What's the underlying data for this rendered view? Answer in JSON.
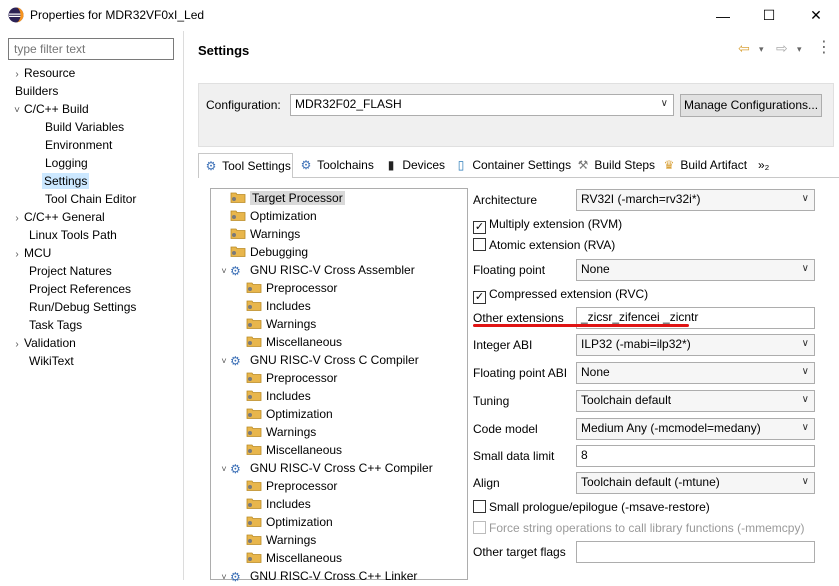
{
  "window": {
    "title": "Properties for MDR32VF0xI_Led",
    "minimize": "—",
    "maximize": "☐",
    "close": "✕"
  },
  "sidebar": {
    "filter_placeholder": "type filter text",
    "items": [
      {
        "label": "Resource",
        "arrow": "›"
      },
      {
        "label": "Builders",
        "arrow": ""
      },
      {
        "label": "C/C++ Build",
        "arrow": "˅"
      },
      {
        "label": "Build Variables",
        "arrow": ""
      },
      {
        "label": "Environment",
        "arrow": ""
      },
      {
        "label": "Logging",
        "arrow": ""
      },
      {
        "label": "Settings",
        "arrow": ""
      },
      {
        "label": "Tool Chain Editor",
        "arrow": ""
      },
      {
        "label": "C/C++ General",
        "arrow": "›"
      },
      {
        "label": "Linux Tools Path",
        "arrow": ""
      },
      {
        "label": "MCU",
        "arrow": "›"
      },
      {
        "label": "Project Natures",
        "arrow": ""
      },
      {
        "label": "Project References",
        "arrow": ""
      },
      {
        "label": "Run/Debug Settings",
        "arrow": ""
      },
      {
        "label": "Task Tags",
        "arrow": ""
      },
      {
        "label": "Validation",
        "arrow": "›"
      },
      {
        "label": "WikiText",
        "arrow": ""
      }
    ]
  },
  "header": {
    "title": "Settings"
  },
  "configuration": {
    "label": "Configuration:",
    "value": "MDR32F02_FLASH",
    "manage_label": "Manage Configurations..."
  },
  "tabs": [
    {
      "label": "Tool Settings"
    },
    {
      "label": "Toolchains"
    },
    {
      "label": "Devices"
    },
    {
      "label": "Container Settings"
    },
    {
      "label": "Build Steps"
    },
    {
      "label": "Build Artifact"
    },
    {
      "label": "»₂"
    }
  ],
  "tool_tree": [
    {
      "label": "Target Processor"
    },
    {
      "label": "Optimization"
    },
    {
      "label": "Warnings"
    },
    {
      "label": "Debugging"
    },
    {
      "label": "GNU RISC-V Cross Assembler",
      "arrow": "˅"
    },
    {
      "label": "Preprocessor"
    },
    {
      "label": "Includes"
    },
    {
      "label": "Warnings"
    },
    {
      "label": "Miscellaneous"
    },
    {
      "label": "GNU RISC-V Cross C Compiler",
      "arrow": "˅"
    },
    {
      "label": "Preprocessor"
    },
    {
      "label": "Includes"
    },
    {
      "label": "Optimization"
    },
    {
      "label": "Warnings"
    },
    {
      "label": "Miscellaneous"
    },
    {
      "label": "GNU RISC-V Cross C++ Compiler",
      "arrow": "˅"
    },
    {
      "label": "Preprocessor"
    },
    {
      "label": "Includes"
    },
    {
      "label": "Optimization"
    },
    {
      "label": "Warnings"
    },
    {
      "label": "Miscellaneous"
    },
    {
      "label": "GNU RISC-V Cross C++ Linker",
      "arrow": "˅"
    }
  ],
  "options": {
    "architecture": {
      "label": "Architecture",
      "value": "RV32I (-march=rv32i*)"
    },
    "multiply": {
      "label": "Multiply extension (RVM)",
      "checked": "✓"
    },
    "atomic": {
      "label": "Atomic extension (RVA)",
      "checked": ""
    },
    "floating_point": {
      "label": "Floating point",
      "value": "None"
    },
    "compressed": {
      "label": "Compressed extension (RVC)",
      "checked": "✓"
    },
    "other_extensions": {
      "label": "Other extensions",
      "value": "_zicsr_zifencei _zicntr"
    },
    "integer_abi": {
      "label": "Integer ABI",
      "value": "ILP32 (-mabi=ilp32*)"
    },
    "floating_point_abi": {
      "label": "Floating point ABI",
      "value": "None"
    },
    "tuning": {
      "label": "Tuning",
      "value": "Toolchain default"
    },
    "code_model": {
      "label": "Code model",
      "value": "Medium Any (-mcmodel=medany)"
    },
    "small_data_limit": {
      "label": "Small data limit",
      "value": "8"
    },
    "align": {
      "label": "Align",
      "value": "Toolchain default (-mtune)"
    },
    "small_prologue": {
      "label": "Small prologue/epilogue (-msave-restore)",
      "checked": ""
    },
    "force_string": {
      "label": "Force string operations to call library functions (-mmemcpy)",
      "checked": ""
    },
    "other_target_flags": {
      "label": "Other target flags",
      "value": ""
    }
  },
  "colors": {
    "accent_highlight": "#e01414",
    "selection": "#cce8ff",
    "folder": "#e8b64c"
  }
}
